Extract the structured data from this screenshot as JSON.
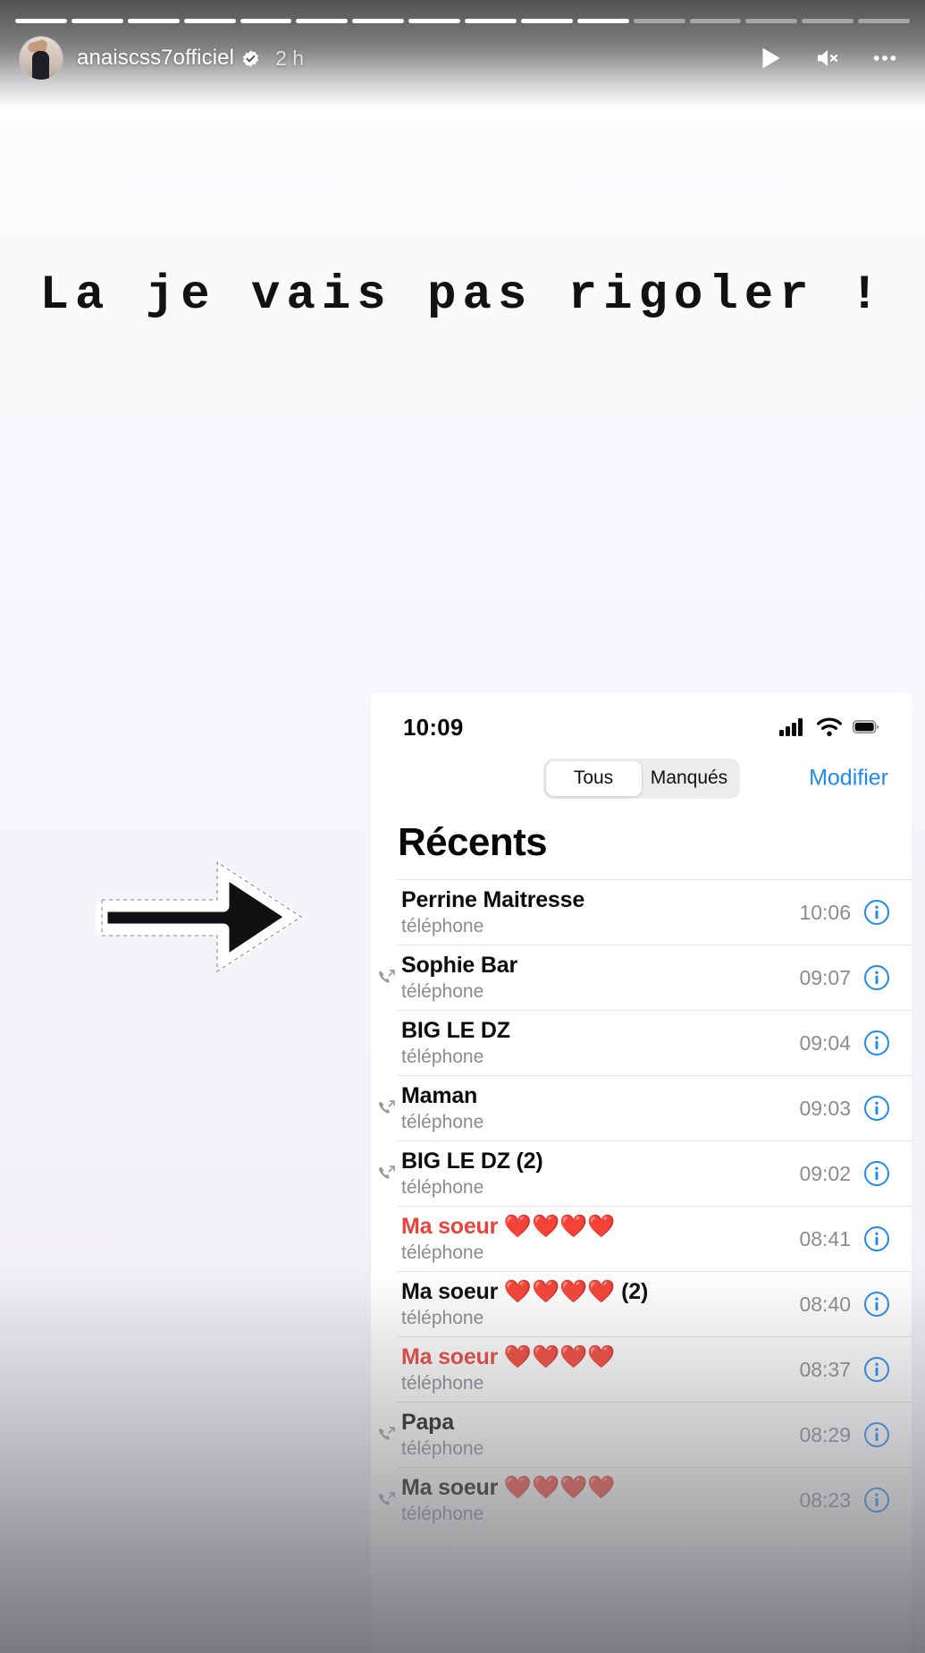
{
  "story": {
    "progress": {
      "total_segments": 16,
      "completed_segments": 11
    },
    "header": {
      "username": "anaiscss7officiel",
      "verified_icon": "verified-badge-icon",
      "timestamp": "2 h",
      "avatar_icon": "profile-avatar",
      "play_icon": "play-icon",
      "mute_icon": "speaker-muted-icon",
      "more_icon": "more-options-icon"
    },
    "overlay_text": "La je vais pas rigoler !",
    "arrow_sticker_icon": "right-arrow-sticker-icon",
    "like_button_icon": "heart-outline-icon"
  },
  "phone_screenshot": {
    "status_bar": {
      "time": "10:09",
      "signal_icon": "cellular-signal-icon",
      "wifi_icon": "wifi-icon",
      "battery_icon": "battery-full-icon"
    },
    "toolbar": {
      "segments": [
        {
          "label": "Tous",
          "active": true
        },
        {
          "label": "Manqués",
          "active": false
        }
      ],
      "edit_label": "Modifier",
      "edit_color": "#1f8af5"
    },
    "title": "Récents",
    "subtitle_label": "téléphone",
    "missed_color": "#e8443b",
    "calls": [
      {
        "name": "Perrine Maitresse",
        "hearts": "",
        "count": "",
        "sub": "téléphone",
        "time": "10:06",
        "missed": false,
        "outgoing": false
      },
      {
        "name": "Sophie Bar",
        "hearts": "",
        "count": "",
        "sub": "téléphone",
        "time": "09:07",
        "missed": false,
        "outgoing": true
      },
      {
        "name": "BIG LE DZ",
        "hearts": "",
        "count": "",
        "sub": "téléphone",
        "time": "09:04",
        "missed": false,
        "outgoing": false
      },
      {
        "name": "Maman",
        "hearts": "",
        "count": "",
        "sub": "téléphone",
        "time": "09:03",
        "missed": false,
        "outgoing": true
      },
      {
        "name": "BIG LE DZ (2)",
        "hearts": "",
        "count": "",
        "sub": "téléphone",
        "time": "09:02",
        "missed": false,
        "outgoing": true
      },
      {
        "name": "Ma soeur ",
        "hearts": "❤️❤️❤️❤️",
        "count": "",
        "sub": "téléphone",
        "time": "08:41",
        "missed": true,
        "outgoing": false
      },
      {
        "name": "Ma soeur ",
        "hearts": "❤️❤️❤️❤️",
        "count": " (2)",
        "sub": "téléphone",
        "time": "08:40",
        "missed": false,
        "outgoing": false
      },
      {
        "name": "Ma soeur ",
        "hearts": "❤️❤️❤️❤️",
        "count": "",
        "sub": "téléphone",
        "time": "08:37",
        "missed": true,
        "outgoing": false
      },
      {
        "name": "Papa",
        "hearts": "",
        "count": "",
        "sub": "téléphone",
        "time": "08:29",
        "missed": false,
        "outgoing": true
      },
      {
        "name": "Ma soeur ",
        "hearts": "❤️❤️❤️❤️",
        "count": "",
        "sub": "téléphone",
        "time": "08:23",
        "missed": false,
        "outgoing": true
      }
    ]
  }
}
